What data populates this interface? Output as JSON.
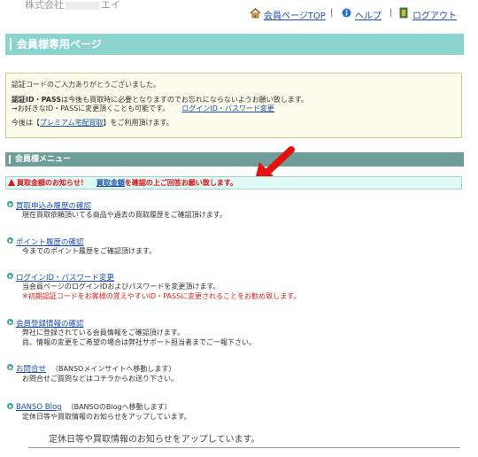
{
  "header": {
    "company_start": "株式会社",
    "company_end": "エイ",
    "links": [
      {
        "label": "会員ページTOP",
        "icon": "house-icon"
      },
      {
        "label": "ヘルプ",
        "icon": "info-icon"
      },
      {
        "label": "ログアウト",
        "icon": "logout-icon"
      }
    ],
    "separator": "|"
  },
  "member_page": {
    "title": "会員様専用ページ"
  },
  "info": {
    "line1": "認証コードのご入力ありがとうございました。",
    "line2_bold": "認証ID・PASS",
    "line2_rest": "は今後も買取時に必要となりますのでお忘れにならないようお願い致します。",
    "line3": "→お好きなID・PASSに変更頂くことも可能です。",
    "line3_link": "ログインID・パスワード変更",
    "line4_pre": "今後は【",
    "line4_link": "プレミアム宅配買取",
    "line4_post": "】をご利用頂けます。"
  },
  "menu": {
    "title": "会員様メニュー",
    "notice_pre": "買取金額のお知らせ！",
    "notice_link": "買取金額",
    "notice_post": "を確認の上ご回答お願い致します。",
    "items": [
      {
        "label": "買取申込み履歴の確認",
        "note": "",
        "desc": [
          "現在買取依頼頂いてる商品や過去の買取履歴をご確認頂けます。"
        ]
      },
      {
        "label": "ポイント履歴の確認",
        "note": "",
        "desc": [
          "今までのポイント履歴をご確認頂けます。"
        ]
      },
      {
        "label": "ログインID・パスワード変更",
        "note": "",
        "desc": [
          "当会員ページのログインIDおよびパスワードを変更頂けます。"
        ],
        "red": "※初期認証コードをお客様の覚えやすいID・PASSに変更されることをお勧め致します。"
      },
      {
        "label": "会員登録情報の確認",
        "note": "",
        "desc": [
          "弊社に登録されている会員情報をご確認頂けます。",
          "尚、情報の変更をご希望の場合は弊社サポート担当者までご一報下さい。"
        ]
      },
      {
        "label": "お問合せ",
        "note": "（BANSOメインサイトへ移動します）",
        "desc": [
          "お問合せご質問などはコチラからお送り下さい。"
        ]
      },
      {
        "label": "BANSO Blog",
        "note": "（BANSOのBlogへ移動します）",
        "desc": [
          "定休日等や買取情報のお知らせをアップしています。"
        ]
      }
    ]
  },
  "footer_text": "定休日等や買取情報のお知らせをアップしています。",
  "colors": {
    "title_bg": "#8bd3ce",
    "menu_bg": "#6f9e99",
    "link": "#1a4db3",
    "alert": "#e0201b"
  }
}
